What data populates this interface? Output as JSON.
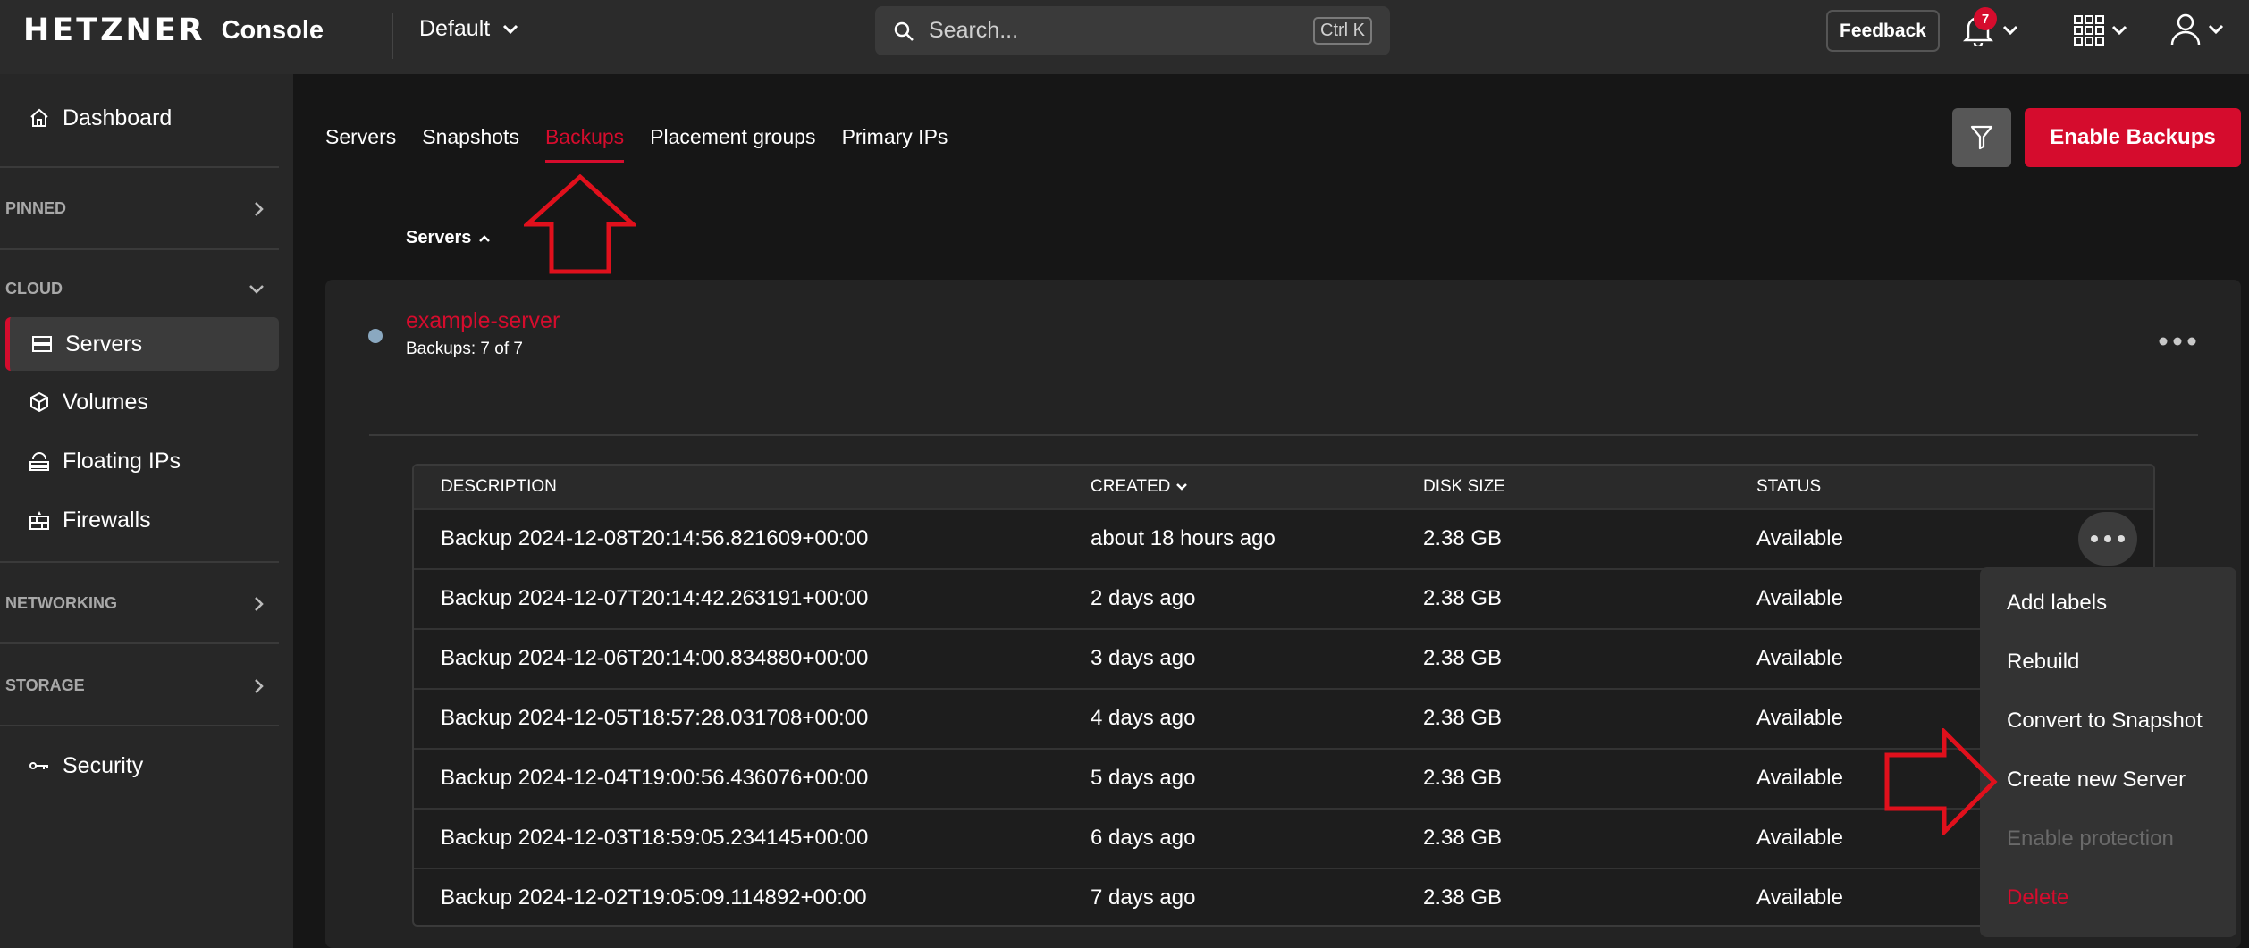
{
  "topbar": {
    "brand": "HETZNER",
    "app": "Console",
    "project": "Default",
    "search_placeholder": "Search...",
    "search_shortcut": "Ctrl K",
    "feedback": "Feedback",
    "notifications_count": "7"
  },
  "sidebar": {
    "dashboard": "Dashboard",
    "sections": {
      "pinned": "PINNED",
      "cloud": "CLOUD",
      "networking": "NETWORKING",
      "storage": "STORAGE"
    },
    "items": {
      "servers": "Servers",
      "volumes": "Volumes",
      "floating_ips": "Floating IPs",
      "firewalls": "Firewalls",
      "security": "Security"
    }
  },
  "tabs": [
    "Servers",
    "Snapshots",
    "Backups",
    "Placement groups",
    "Primary IPs"
  ],
  "active_tab": "Backups",
  "enable_backups": "Enable Backups",
  "sort_label": "Servers",
  "server": {
    "name": "example-server",
    "backups": "Backups: 7 of 7"
  },
  "table": {
    "headers": {
      "description": "DESCRIPTION",
      "created": "CREATED",
      "disk_size": "DISK SIZE",
      "status": "STATUS"
    },
    "rows": [
      {
        "description": "Backup 2024-12-08T20:14:56.821609+00:00",
        "created": "about 18 hours ago",
        "size": "2.38 GB",
        "status": "Available"
      },
      {
        "description": "Backup 2024-12-07T20:14:42.263191+00:00",
        "created": "2 days ago",
        "size": "2.38 GB",
        "status": "Available"
      },
      {
        "description": "Backup 2024-12-06T20:14:00.834880+00:00",
        "created": "3 days ago",
        "size": "2.38 GB",
        "status": "Available"
      },
      {
        "description": "Backup 2024-12-05T18:57:28.031708+00:00",
        "created": "4 days ago",
        "size": "2.38 GB",
        "status": "Available"
      },
      {
        "description": "Backup 2024-12-04T19:00:56.436076+00:00",
        "created": "5 days ago",
        "size": "2.38 GB",
        "status": "Available"
      },
      {
        "description": "Backup 2024-12-03T18:59:05.234145+00:00",
        "created": "6 days ago",
        "size": "2.38 GB",
        "status": "Available"
      },
      {
        "description": "Backup 2024-12-02T19:05:09.114892+00:00",
        "created": "7 days ago",
        "size": "2.38 GB",
        "status": "Available"
      }
    ]
  },
  "context_menu": {
    "add_labels": "Add labels",
    "rebuild": "Rebuild",
    "convert": "Convert to Snapshot",
    "create_server": "Create new Server",
    "enable_protection": "Enable protection",
    "delete": "Delete"
  },
  "colors": {
    "accent": "#d50c2d",
    "topbar": "#2b2b2b",
    "sidebar": "#272727",
    "background": "#161616"
  }
}
